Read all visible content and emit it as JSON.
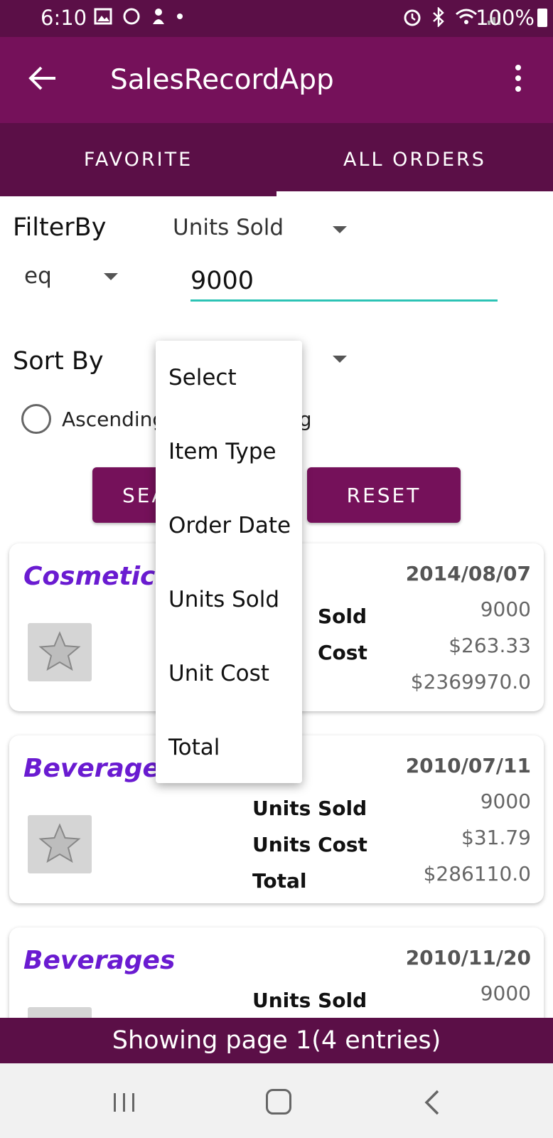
{
  "status_bar": {
    "time": "6:10",
    "battery": "100%"
  },
  "app_bar": {
    "title": "SalesRecordApp"
  },
  "tabs": [
    {
      "label": "FAVORITE"
    },
    {
      "label": "ALL ORDERS"
    }
  ],
  "filter": {
    "label": "FilterBy",
    "field": "Units Sold",
    "operator": "eq",
    "value": "9000"
  },
  "sort": {
    "label": "Sort By",
    "ascending": "Ascending",
    "descending_partial": "ng"
  },
  "buttons": {
    "search": "SEA",
    "reset": "RESET"
  },
  "sort_options": [
    "Select",
    "Item Type",
    "Order Date",
    "Units Sold",
    "Unit Cost",
    "Total"
  ],
  "orders": [
    {
      "category": "Cosmetics",
      "date": "2014/08/07",
      "labels": {
        "units_sold": "Sold",
        "units_cost": "Cost",
        "total": ""
      },
      "units_sold": "9000",
      "unit_cost": "$263.33",
      "total": "$2369970.0"
    },
    {
      "category": "Beverages",
      "date": "2010/07/11",
      "labels": {
        "units_sold": "Units Sold",
        "units_cost": "Units Cost",
        "total": "Total"
      },
      "units_sold": "9000",
      "unit_cost": "$31.79",
      "total": "$286110.0"
    },
    {
      "category": "Beverages",
      "date": "2010/11/20",
      "labels": {
        "units_sold": "Units Sold"
      },
      "units_sold": "9000"
    }
  ],
  "footer": {
    "text": "Showing page 1(4 entries)"
  },
  "colors": {
    "primary": "#75115a",
    "primary_dark": "#5b0f47",
    "accent": "#2cc3b5",
    "category": "#6a1bd1"
  },
  "icons": [
    "back-arrow-icon",
    "more-vert-icon",
    "star-icon",
    "recents-icon",
    "home-icon",
    "nav-back-icon",
    "image-icon",
    "alarm-icon",
    "bluetooth-icon",
    "wifi-icon",
    "signal-icon",
    "battery-icon"
  ]
}
